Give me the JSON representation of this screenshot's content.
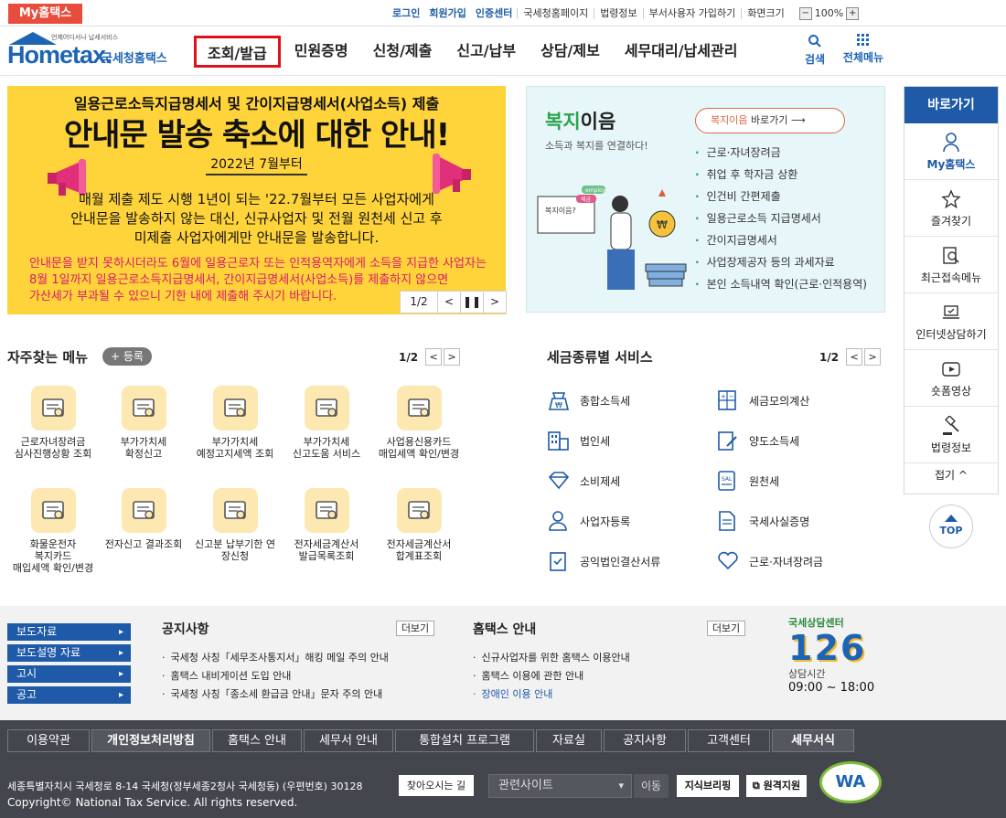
{
  "topbar": {
    "my_hometax": "My홈택스",
    "links": [
      "로그인",
      "회원가입",
      "인증센터",
      "국세청홈페이지",
      "법령정보",
      "부서사용자 가입하기",
      "화면크기"
    ],
    "zoom": "100%"
  },
  "header": {
    "logo_sub": "언제어디서나 납세서비스",
    "logo_main": "Hometax.",
    "logo_kr": "국세청홈택스",
    "nav": [
      "조회/발급",
      "민원증명",
      "신청/제출",
      "신고/납부",
      "상담/제보",
      "세무대리/납세관리"
    ],
    "search": "검색",
    "all_menu": "전체메뉴"
  },
  "banner": {
    "line1": "일용근로소득지급명세서 및 간이지급명세서(사업소득) 제출",
    "line2": "안내문 발송 축소에 대한 안내!",
    "date": "2022년 7월부터",
    "body": [
      "매월 제출 제도 시행 1년이 되는 '22.7월부터 모든 사업자에게",
      "안내문을 발송하지 않는 대신, 신규사업자 및 전월 원천세 신고 후",
      "미제출 사업자에게만 안내문을 발송합니다."
    ],
    "red": [
      "안내문을 받지 못하시더라도 6월에 일용근로자 또는 인적용역자에게 소득을 지급한 사업자는",
      "8월 1일까지 일용근로소득지급명세서, 간이지급명세서(사업소득)를 제출하지 않으면",
      "가산세가 부과될 수 있으니 기한 내에 제출해 주시기 바랍니다."
    ],
    "page": "1/2"
  },
  "welfare": {
    "title_green": "복지",
    "title_rest": "이음",
    "subtitle": "소득과 복지를 연결하다!",
    "go_green": "복지이음",
    "go_rest": "바로가기",
    "items": [
      "근로·자녀장려금",
      "취업 후 학자금 상환",
      "인건비 간편제출",
      "일용근로소득 지급명세서",
      "간이지급명세서",
      "사업장제공자 등의 과세자료",
      "본인 소득내역 확인(근로·인적용역)"
    ],
    "img_labels": [
      "복지이음?",
      "employ",
      "세금"
    ]
  },
  "quick": {
    "title": "바로가기",
    "items": [
      "My홈택스",
      "즐겨찾기",
      "최근접속메뉴",
      "인터넷상담하기",
      "숏폼영상",
      "법령정보"
    ],
    "fold": "접기 ^",
    "top": "TOP"
  },
  "favorites": {
    "title": "자주찾는 메뉴",
    "add": "+ 등록",
    "page": "1/2",
    "items": [
      [
        "근로자녀장려금",
        "심사진행상황 조회"
      ],
      [
        "부가가치세",
        "확정신고"
      ],
      [
        "부가가치세",
        "예정고지세액 조회"
      ],
      [
        "부가가치세",
        "신고도움 서비스"
      ],
      [
        "사업용신용카드",
        "매입세액 확인/변경"
      ],
      [
        "화물운전자",
        "복지카드",
        "매입세액 확인/변경"
      ],
      [
        "전자신고 결과조회"
      ],
      [
        "신고분 납부기한 연",
        "장신청"
      ],
      [
        "전자세금계산서",
        "발급목록조회"
      ],
      [
        "전자세금계산서",
        "합계표조회"
      ]
    ]
  },
  "taxtypes": {
    "title": "세금종류별 서비스",
    "page": "1/2",
    "left": [
      "종합소득세",
      "법인세",
      "소비제세",
      "사업자등록",
      "공익법인결산서류"
    ],
    "right": [
      "세금모의계산",
      "양도소득세",
      "원천세",
      "국세사실증명",
      "근로·자녀장려금"
    ]
  },
  "notice": {
    "side_links": [
      "보도자료",
      "보도설명 자료",
      "고시",
      "공고"
    ],
    "notice_title": "공지사항",
    "notice_more": "더보기",
    "notice_items": [
      "국세청 사칭「세무조사통지서」해킹 메일 주의 안내",
      "홈택스 내비게이션 도입 안내",
      "국세청 사칭「종소세 환급금 안내」문자 주의 안내"
    ],
    "guide_title": "홈택스 안내",
    "guide_more": "더보기",
    "guide_items": [
      "신규사업자를 위한 홈택스 이용안내",
      "홈택스 이용에 관한 안내",
      "장애인 이용 안내"
    ],
    "center_label": "국세상담센터",
    "center_number": "126",
    "hours_label": "상담시간",
    "hours": "09:00 ~ 18:00"
  },
  "footer": {
    "nav": [
      "이용약관",
      "개인정보처리방침",
      "홈택스 안내",
      "세무서 안내",
      "통합설치 프로그램",
      "자료실",
      "공지사항",
      "고객센터",
      "세무서식"
    ],
    "address": "세종특별자치시 국세청로 8-14 국세청(정부세종2청사 국세청동) (우편번호) 30128",
    "find": "찾아오시는 길",
    "related": "관련사이트",
    "move": "이동",
    "briefing": "지식브리핑",
    "remote": "원격지원",
    "copyright": "Copyright© National Tax Service. All rights reserved.",
    "wa": "WA"
  },
  "colors": {
    "brand": "#1e5aa8",
    "alert": "#e84c3d",
    "banner": "#ffd33a",
    "welfare_bg": "#e7f6f8"
  }
}
